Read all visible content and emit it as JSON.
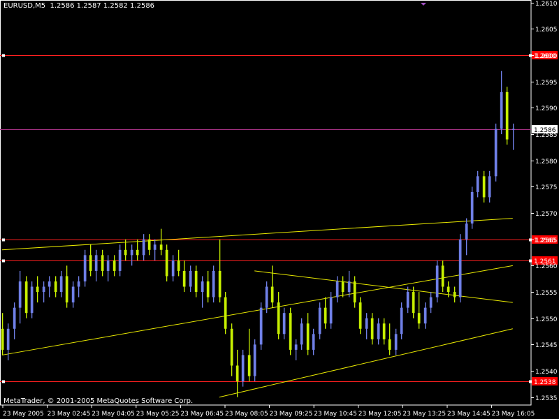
{
  "header": {
    "symbol": "EURUSD,M5",
    "open": "1.2586",
    "high": "1.2587",
    "low": "1.2582",
    "close": "1.2586"
  },
  "footer": {
    "copyright": "MetaTrader, © 2001-2005 MetaQuotes Software Corp."
  },
  "colors": {
    "background": "#000000",
    "frame": "#ffffff",
    "bull_bar": "#7080e8",
    "bear_bar": "#c8f000",
    "trendline": "#e8e800",
    "level_line": "#ff2020",
    "bid_line": "#a03080",
    "level_label_bg": "#ff0000",
    "bid_label_bg": "#ffffff"
  },
  "chart_data": {
    "type": "bar",
    "subtype": "ohlc",
    "timeframe": "M5",
    "ylim": [
      1.25335,
      1.26105
    ],
    "y_ticks": [
      "1.2535",
      "1.2540",
      "1.2545",
      "1.2550",
      "1.2555",
      "1.2560",
      "1.2565",
      "1.2570",
      "1.2575",
      "1.2580",
      "1.2585",
      "1.2590",
      "1.2595",
      "1.2600",
      "1.2605",
      "1.2610"
    ],
    "x_ticks": [
      "23 May 2005",
      "23 May 02:45",
      "23 May 04:05",
      "23 May 05:25",
      "23 May 06:45",
      "23 May 08:05",
      "23 May 09:25",
      "23 May 10:45",
      "23 May 12:05",
      "23 May 13:25",
      "23 May 14:45",
      "23 May 16:05"
    ],
    "bars": [
      [
        1.2548,
        1.2551,
        1.2543,
        1.2544
      ],
      [
        1.2544,
        1.2549,
        1.2542,
        1.2548
      ],
      [
        1.2548,
        1.2553,
        1.2546,
        1.2552
      ],
      [
        1.2552,
        1.2559,
        1.2549,
        1.2557
      ],
      [
        1.2557,
        1.2558,
        1.255,
        1.2551
      ],
      [
        1.2551,
        1.2557,
        1.255,
        1.2556
      ],
      [
        1.2556,
        1.2558,
        1.2553,
        1.2555
      ],
      [
        1.2555,
        1.2557,
        1.2553,
        1.2556
      ],
      [
        1.2556,
        1.2558,
        1.2554,
        1.2557
      ],
      [
        1.2557,
        1.2558,
        1.2554,
        1.2555
      ],
      [
        1.2555,
        1.2559,
        1.2554,
        1.2558
      ],
      [
        1.2558,
        1.256,
        1.2552,
        1.2553
      ],
      [
        1.2553,
        1.2557,
        1.2552,
        1.2556
      ],
      [
        1.2556,
        1.2558,
        1.2554,
        1.2557
      ],
      [
        1.2557,
        1.2563,
        1.2556,
        1.2562
      ],
      [
        1.2562,
        1.2564,
        1.2558,
        1.2559
      ],
      [
        1.2559,
        1.2563,
        1.2557,
        1.2562
      ],
      [
        1.2562,
        1.2563,
        1.2558,
        1.2559
      ],
      [
        1.2559,
        1.2562,
        1.2557,
        1.2561
      ],
      [
        1.2561,
        1.2562,
        1.2558,
        1.2559
      ],
      [
        1.2559,
        1.2564,
        1.2558,
        1.2563
      ],
      [
        1.2563,
        1.2565,
        1.2561,
        1.2562
      ],
      [
        1.2562,
        1.2564,
        1.256,
        1.2563
      ],
      [
        1.2563,
        1.2565,
        1.2561,
        1.2562
      ],
      [
        1.2562,
        1.2566,
        1.2561,
        1.2565
      ],
      [
        1.2565,
        1.2566,
        1.2562,
        1.2563
      ],
      [
        1.2563,
        1.2565,
        1.2561,
        1.2564
      ],
      [
        1.2564,
        1.2567,
        1.2562,
        1.2563
      ],
      [
        1.2563,
        1.2564,
        1.2557,
        1.2558
      ],
      [
        1.2558,
        1.2562,
        1.2557,
        1.2561
      ],
      [
        1.2561,
        1.2563,
        1.2558,
        1.2559
      ],
      [
        1.2559,
        1.2561,
        1.2555,
        1.2556
      ],
      [
        1.2556,
        1.256,
        1.2555,
        1.2559
      ],
      [
        1.2559,
        1.256,
        1.2554,
        1.2555
      ],
      [
        1.2555,
        1.2558,
        1.2552,
        1.2557
      ],
      [
        1.2557,
        1.2559,
        1.2553,
        1.2554
      ],
      [
        1.2554,
        1.256,
        1.2553,
        1.2559
      ],
      [
        1.2559,
        1.2565,
        1.2553,
        1.2554
      ],
      [
        1.2554,
        1.2555,
        1.2547,
        1.2548
      ],
      [
        1.2548,
        1.2549,
        1.2539,
        1.2541
      ],
      [
        1.2541,
        1.2544,
        1.2535,
        1.2538
      ],
      [
        1.2538,
        1.2544,
        1.2537,
        1.2543
      ],
      [
        1.2543,
        1.2548,
        1.2538,
        1.2539
      ],
      [
        1.2539,
        1.2546,
        1.2538,
        1.2545
      ],
      [
        1.2545,
        1.2553,
        1.2544,
        1.2552
      ],
      [
        1.2552,
        1.2557,
        1.2551,
        1.2556
      ],
      [
        1.2556,
        1.256,
        1.2552,
        1.2553
      ],
      [
        1.2553,
        1.2555,
        1.2546,
        1.2547
      ],
      [
        1.2547,
        1.2552,
        1.2546,
        1.2551
      ],
      [
        1.2551,
        1.2552,
        1.2543,
        1.2544
      ],
      [
        1.2544,
        1.2546,
        1.2542,
        1.2545
      ],
      [
        1.2545,
        1.255,
        1.2544,
        1.2549
      ],
      [
        1.2549,
        1.2551,
        1.2543,
        1.2544
      ],
      [
        1.2544,
        1.2548,
        1.2543,
        1.2547
      ],
      [
        1.2547,
        1.2553,
        1.2546,
        1.2552
      ],
      [
        1.2552,
        1.2554,
        1.2548,
        1.2549
      ],
      [
        1.2549,
        1.2555,
        1.2548,
        1.2554
      ],
      [
        1.2554,
        1.2558,
        1.2553,
        1.2557
      ],
      [
        1.2557,
        1.2558,
        1.2554,
        1.2555
      ],
      [
        1.2555,
        1.2559,
        1.2554,
        1.2557
      ],
      [
        1.2557,
        1.2558,
        1.2552,
        1.2553
      ],
      [
        1.2553,
        1.2554,
        1.2547,
        1.2548
      ],
      [
        1.2548,
        1.2551,
        1.2546,
        1.255
      ],
      [
        1.255,
        1.2551,
        1.2545,
        1.2546
      ],
      [
        1.2546,
        1.255,
        1.2545,
        1.2549
      ],
      [
        1.2549,
        1.255,
        1.2545,
        1.2546
      ],
      [
        1.2546,
        1.2549,
        1.2543,
        1.2544
      ],
      [
        1.2544,
        1.2548,
        1.2543,
        1.2547
      ],
      [
        1.2547,
        1.2553,
        1.2546,
        1.2552
      ],
      [
        1.2552,
        1.2556,
        1.2551,
        1.2555
      ],
      [
        1.2555,
        1.2556,
        1.255,
        1.2551
      ],
      [
        1.2551,
        1.2555,
        1.2548,
        1.2549
      ],
      [
        1.2549,
        1.2553,
        1.2548,
        1.2552
      ],
      [
        1.2552,
        1.2555,
        1.2551,
        1.2554
      ],
      [
        1.2554,
        1.2561,
        1.2553,
        1.256
      ],
      [
        1.256,
        1.2561,
        1.2555,
        1.2556
      ],
      [
        1.2556,
        1.2557,
        1.2554,
        1.2555
      ],
      [
        1.2555,
        1.2556,
        1.2553,
        1.2554
      ],
      [
        1.2554,
        1.2566,
        1.2553,
        1.2565
      ],
      [
        1.2565,
        1.2569,
        1.2562,
        1.2568
      ],
      [
        1.2568,
        1.2575,
        1.2567,
        1.2574
      ],
      [
        1.2574,
        1.2578,
        1.2573,
        1.2577
      ],
      [
        1.2577,
        1.2578,
        1.2572,
        1.2573
      ],
      [
        1.2573,
        1.2578,
        1.2572,
        1.2577
      ],
      [
        1.2577,
        1.2587,
        1.2576,
        1.2586
      ],
      [
        1.2586,
        1.2597,
        1.2585,
        1.2593
      ],
      [
        1.2593,
        1.2594,
        1.2583,
        1.2584
      ],
      [
        1.2586,
        1.2587,
        1.2582,
        1.2586
      ]
    ],
    "trendlines": [
      {
        "from": [
          0,
          1.2543
        ],
        "to": [
          87,
          1.256
        ]
      },
      {
        "from": [
          0,
          1.2563
        ],
        "to": [
          87,
          1.2569
        ]
      },
      {
        "from": [
          37,
          1.2535
        ],
        "to": [
          87,
          1.2548
        ]
      },
      {
        "from": [
          43,
          1.2559
        ],
        "to": [
          87,
          1.2553
        ]
      }
    ],
    "levels": [
      "1.2600",
      "1.2565",
      "1.2561",
      "1.2538"
    ],
    "bid": "1.2586"
  }
}
